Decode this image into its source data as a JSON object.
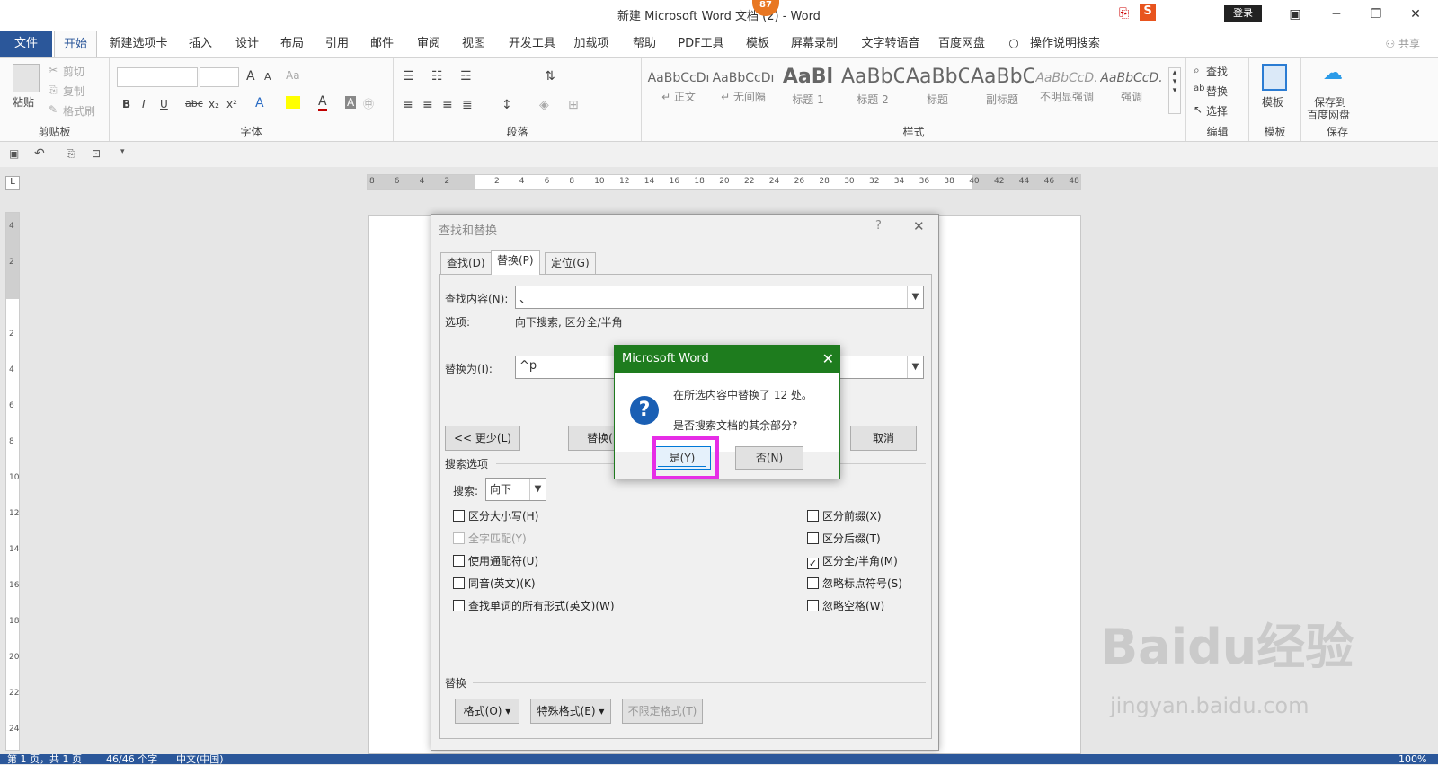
{
  "window": {
    "title": "新建 Microsoft Word 文档 (2) - Word",
    "badge": "87",
    "login": "登录",
    "minimize": "─",
    "restore": "❐",
    "close": "✕",
    "ribbon_display": "▣"
  },
  "tabs": [
    "文件",
    "开始",
    "新建选项卡",
    "插入",
    "设计",
    "布局",
    "引用",
    "邮件",
    "审阅",
    "视图",
    "开发工具",
    "加载项",
    "帮助",
    "PDF工具",
    "模板",
    "屏幕录制",
    "文字转语音",
    "百度网盘"
  ],
  "tellme": "操作说明搜索",
  "share": "共享",
  "ribbon": {
    "clipboard": {
      "paste": "粘贴",
      "cut": "剪切",
      "copy": "复制",
      "format_painter": "格式刷",
      "label": "剪贴板"
    },
    "font": {
      "label": "字体",
      "bold": "B",
      "italic": "I",
      "underline": "U",
      "strike": "abc",
      "sub": "x₂",
      "sup": "x²",
      "grow": "A",
      "shrink": "A",
      "clear": "Aa"
    },
    "paragraph": {
      "label": "段落"
    },
    "styles": {
      "label": "样式",
      "items": [
        {
          "sample": "AaBbCcDı",
          "name": "↵ 正文"
        },
        {
          "sample": "AaBbCcDı",
          "name": "↵ 无间隔"
        },
        {
          "sample": "AaBl",
          "name": "标题 1"
        },
        {
          "sample": "AaBbC",
          "name": "标题 2"
        },
        {
          "sample": "AaBbC",
          "name": "标题"
        },
        {
          "sample": "AaBbC",
          "name": "副标题"
        },
        {
          "sample": "AaBbCcD.",
          "name": "不明显强调"
        },
        {
          "sample": "AaBbCcD.",
          "name": "强调"
        }
      ]
    },
    "editing": {
      "label": "编辑",
      "find": "查找",
      "replace": "替换",
      "select": "选择"
    },
    "template": {
      "label": "模板",
      "btn": "模板"
    },
    "save": {
      "label": "保存",
      "btn1": "保存到",
      "btn2": "百度网盘"
    }
  },
  "ruler": {
    "h": [
      "8",
      "6",
      "4",
      "2",
      "",
      "2",
      "4",
      "6",
      "8",
      "10",
      "12",
      "14",
      "16",
      "18",
      "20",
      "22",
      "24",
      "26",
      "28",
      "30",
      "32",
      "34",
      "36",
      "38",
      "40",
      "42",
      "44",
      "46",
      "48"
    ],
    "v": [
      "4",
      "2",
      "",
      "2",
      "4",
      "6",
      "8",
      "10",
      "12",
      "14",
      "16",
      "18",
      "20",
      "22",
      "24"
    ]
  },
  "find_replace": {
    "title": "查找和替换",
    "help": "?",
    "close": "✕",
    "tabs": [
      "查找(D)",
      "替换(P)",
      "定位(G)"
    ],
    "find_label": "查找内容(N):",
    "find_value": "、",
    "options_label": "选项:",
    "options_value": "向下搜索, 区分全/半角",
    "replace_label": "替换为(I):",
    "replace_value": "^p",
    "less_btn": "<< 更少(L)",
    "replace_btn": "替换(R)",
    "cancel_btn": "取消",
    "search_options": "搜索选项",
    "search_label": "搜索:",
    "search_value": "向下",
    "left_checks": [
      {
        "label": "区分大小写(H)",
        "checked": false,
        "disabled": false
      },
      {
        "label": "全字匹配(Y)",
        "checked": false,
        "disabled": true
      },
      {
        "label": "使用通配符(U)",
        "checked": false,
        "disabled": false
      },
      {
        "label": "同音(英文)(K)",
        "checked": false,
        "disabled": false
      },
      {
        "label": "查找单词的所有形式(英文)(W)",
        "checked": false,
        "disabled": false
      }
    ],
    "right_checks": [
      {
        "label": "区分前缀(X)",
        "checked": false
      },
      {
        "label": "区分后缀(T)",
        "checked": false
      },
      {
        "label": "区分全/半角(M)",
        "checked": true
      },
      {
        "label": "忽略标点符号(S)",
        "checked": false
      },
      {
        "label": "忽略空格(W)",
        "checked": false
      }
    ],
    "replace_section": "替换",
    "format_btn": "格式(O) ▾",
    "special_btn": "特殊格式(E) ▾",
    "noformat_btn": "不限定格式(T)"
  },
  "msgbox": {
    "title": "Microsoft Word",
    "close": "✕",
    "icon": "?",
    "line1": "在所选内容中替换了 12 处。",
    "line2": "是否搜索文档的其余部分?",
    "yes": "是(Y)",
    "no": "否(N)"
  },
  "status": {
    "page": "第 1 页，共 1 页",
    "words": "46/46 个字",
    "lang": "中文(中国)",
    "zoom": "100%"
  },
  "watermark": {
    "line1": "Baidu经验",
    "line2": "jingyan.baidu.com"
  }
}
